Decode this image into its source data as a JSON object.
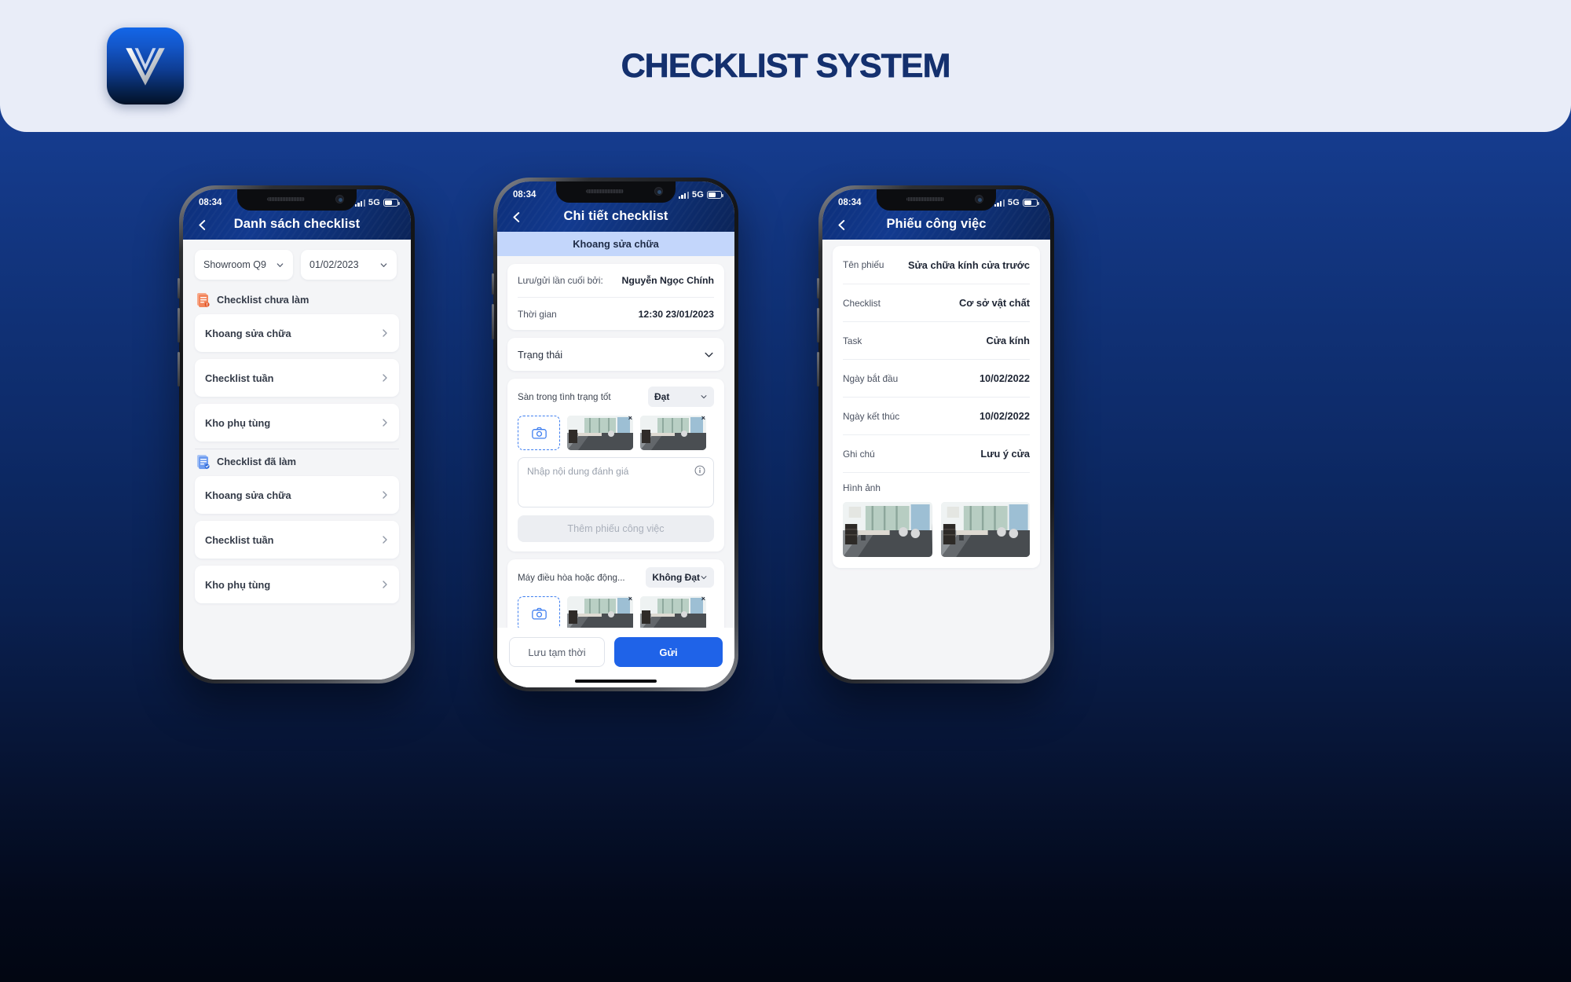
{
  "banner": {
    "title": "CHECKLIST SYSTEM",
    "logo_name": "vinfast-v-logo"
  },
  "colors": {
    "brand_blue": "#1f63e8",
    "dark_navy": "#0d2f7a",
    "banner_bg": "#e9edf8",
    "accent_light_blue": "#c3d6fb"
  },
  "status_bar": {
    "time": "08:34",
    "network": "5G"
  },
  "phone1": {
    "title": "Danh sách checklist",
    "filters": {
      "location": "Showroom Q9",
      "date": "01/02/2023"
    },
    "sections": [
      {
        "icon": "pending-document-icon",
        "heading": "Checklist chưa làm",
        "items": [
          "Khoang sửa chữa",
          "Checklist tuần",
          "Kho phụ tùng"
        ]
      },
      {
        "icon": "done-document-icon",
        "heading": "Checklist đã làm",
        "items": [
          "Khoang sửa chữa",
          "Checklist tuần",
          "Kho phụ tùng"
        ]
      }
    ]
  },
  "phone2": {
    "title": "Chi tiết checklist",
    "category_banner": "Khoang sửa chữa",
    "meta": [
      {
        "label": "Lưu/gửi lần cuối bởi:",
        "value": "Nguyễn Ngọc Chính"
      },
      {
        "label": "Thời gian",
        "value": "12:30 23/01/2023"
      }
    ],
    "status_dropdown": "Trạng thái",
    "questions": [
      {
        "label": "Sàn trong tình trạng tốt",
        "result": "Đạt",
        "photo_count": 2,
        "note_placeholder": "Nhập nội dung đánh giá",
        "add_ticket_label": "Thêm phiếu công việc"
      },
      {
        "label": "Máy điều hòa hoặc động...",
        "result": "Không Đạt",
        "photo_count": 2
      }
    ],
    "actions": {
      "secondary": "Lưu tạm thời",
      "primary": "Gửi"
    }
  },
  "phone3": {
    "title": "Phiếu công việc",
    "rows": [
      {
        "label": "Tên phiếu",
        "value": "Sửa chữa kính cửa trước"
      },
      {
        "label": "Checklist",
        "value": "Cơ sở vật chất"
      },
      {
        "label": "Task",
        "value": "Cửa kính"
      },
      {
        "label": "Ngày bắt đầu",
        "value": "10/02/2022"
      },
      {
        "label": "Ngày kết thúc",
        "value": "10/02/2022"
      },
      {
        "label": "Ghi chú",
        "value": "Lưu ý cửa"
      }
    ],
    "images_label": "Hình ảnh",
    "image_count": 2
  }
}
